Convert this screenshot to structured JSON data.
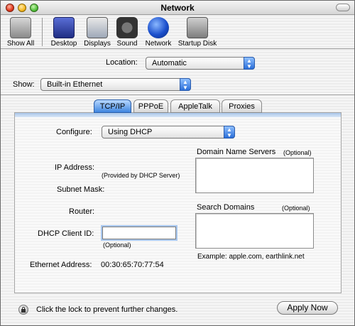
{
  "window": {
    "title": "Network"
  },
  "toolbar": {
    "items": [
      {
        "label": "Show All",
        "icon": "apple-icon"
      },
      {
        "label": "Desktop",
        "icon": "desktop-icon"
      },
      {
        "label": "Displays",
        "icon": "display-icon"
      },
      {
        "label": "Sound",
        "icon": "speaker-icon"
      },
      {
        "label": "Network",
        "icon": "globe-icon"
      },
      {
        "label": "Startup Disk",
        "icon": "disk-icon"
      }
    ]
  },
  "location": {
    "label": "Location:",
    "value": "Automatic"
  },
  "show": {
    "label": "Show:",
    "value": "Built-in Ethernet"
  },
  "tabs": [
    "TCP/IP",
    "PPPoE",
    "AppleTalk",
    "Proxies"
  ],
  "tcpip": {
    "configure_label": "Configure:",
    "configure_value": "Using DHCP",
    "ip_label": "IP Address:",
    "ip_note": "(Provided by DHCP Server)",
    "subnet_label": "Subnet Mask:",
    "router_label": "Router:",
    "dhcp_label": "DHCP Client ID:",
    "dhcp_value": "",
    "dhcp_note": "(Optional)",
    "ethernet_label": "Ethernet Address:",
    "ethernet_value": "00:30:65:70:77:54",
    "dns_label": "Domain Name Servers",
    "dns_optional": "(Optional)",
    "search_label": "Search Domains",
    "search_optional": "(Optional)",
    "example": "Example: apple.com, earthlink.net"
  },
  "footer": {
    "lock_text": "Click the lock to prevent further changes.",
    "apply_label": "Apply Now"
  }
}
